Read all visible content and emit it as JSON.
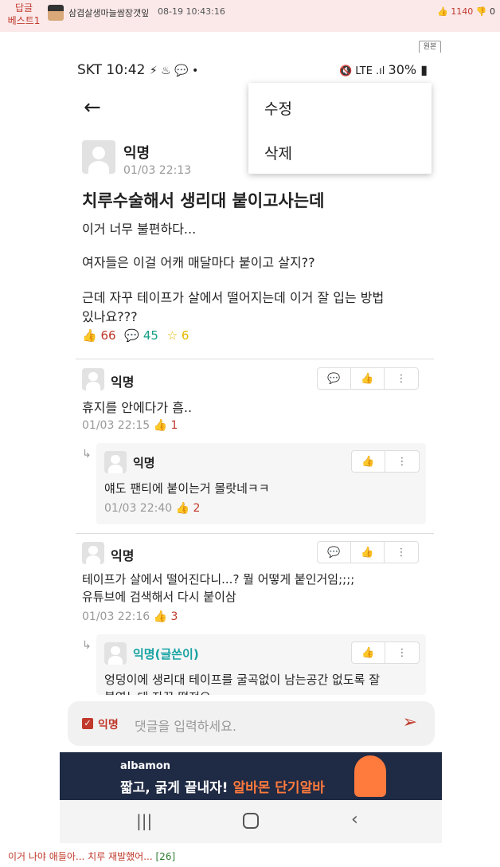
{
  "post_header": {
    "reply_label": "답글",
    "best_label": "베스트1",
    "nickname": "삼겹살생마늘쌈장갯잎",
    "timestamp": "08-19 10:43:16",
    "upvotes": "1140",
    "downvotes": "0",
    "original_label": "원본"
  },
  "status_bar": {
    "left": "SKT 10:42",
    "battery": "30%"
  },
  "menu": {
    "edit": "수정",
    "delete": "삭제"
  },
  "post": {
    "author": "익명",
    "time": "01/03 22:13",
    "title": "치루수술해서 생리대 붙이고사는데",
    "body": [
      "이거 너무 불편하다...",
      "여자들은 이걸 어캐 매달마다 붙이고 살지??",
      "근데 자꾸 테이프가 살에서 떨어지는데 이거 잘 입는 방법",
      "있나요???"
    ],
    "likes": "66",
    "comments": "45",
    "scraps": "6"
  },
  "comments": [
    {
      "author": "익명",
      "text": "휴지를 안에다가 흠..",
      "time": "01/03 22:15",
      "likes": "1"
    },
    {
      "author": "익명",
      "text": "얘도 팬티에 붙이는거 몰랏네ㅋㅋ",
      "time": "01/03 22:40",
      "likes": "2"
    },
    {
      "author": "익명",
      "text1": "테이프가 살에서 떨어진다니...? 뭘 어떻게 붙인거임;;;;",
      "text2": "유튜브에 검색해서 다시 붙이삼",
      "time": "01/03 22:16",
      "likes": "3"
    },
    {
      "author": "익명(글쓴이)",
      "text1": "엉덩이에 생리대 테이프를 굴곡없이 남는공간 없도록 잘",
      "text2": "붙였는데 자꾸 떨져요"
    }
  ],
  "input": {
    "anon_label": "익명",
    "placeholder": "댓글을 입력하세요."
  },
  "banner": {
    "brand": "albamon",
    "slogan": "짧고, 굵게 끝내자!",
    "highlight": "알바몬 단기알바"
  },
  "footer": {
    "text": "이거 나야 애들아... 치루 재발했어...",
    "count": "[26]"
  },
  "colors": {
    "accent_red": "#c0392b",
    "teal": "#16a085",
    "author_teal": "#17a2a2",
    "star_yellow": "#e6b800"
  }
}
